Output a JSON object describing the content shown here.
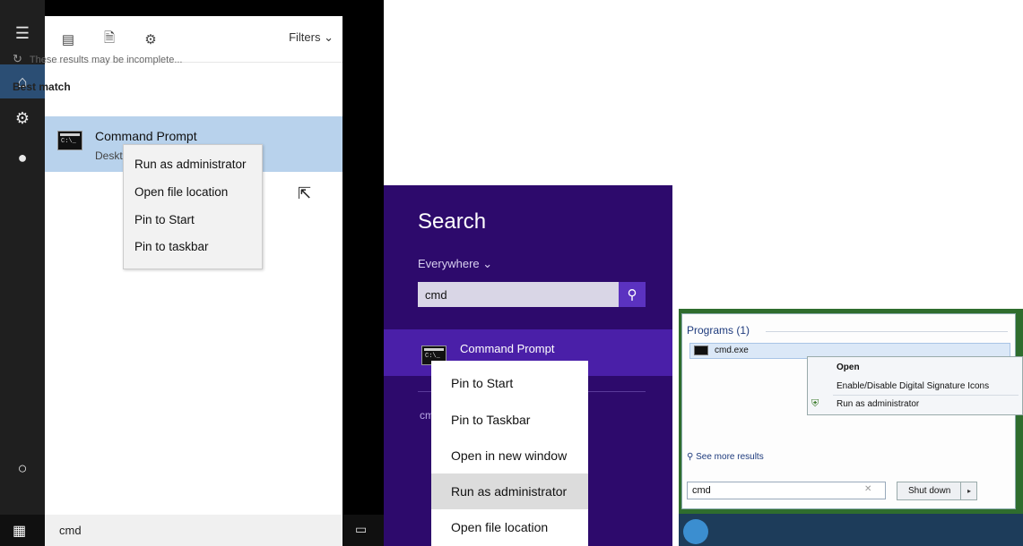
{
  "win10": {
    "rail_icons": [
      "hamburger-icon",
      "home-icon",
      "gear-icon",
      "user-icon",
      "cortana-circle-icon",
      "windows-logo-icon"
    ],
    "toolbar_icons": [
      "apps-icon",
      "documents-icon",
      "settings-icon"
    ],
    "filters_label": "Filters",
    "incomplete_note": "These results may be incomplete...",
    "best_match_heading": "Best match",
    "result_name": "Command Prompt",
    "result_sub": "Deskt",
    "context_menu": [
      "Run as administrator",
      "Open file location",
      "Pin to Start",
      "Pin to taskbar"
    ],
    "search_query": "cmd"
  },
  "win8": {
    "title": "Search",
    "scope": "Everywhere",
    "query": "cmd",
    "result_name": "Command Prompt",
    "sub_fragment": "cm",
    "context_menu": [
      "Pin to Start",
      "Pin to Taskbar",
      "Open in new window",
      "Run as administrator",
      "Open file location"
    ],
    "highlight_index": 3
  },
  "win7": {
    "programs_heading": "Programs (1)",
    "result_name": "cmd.exe",
    "context_menu": [
      "Open",
      "Enable/Disable Digital Signature Icons",
      "Run as administrator"
    ],
    "see_more": "See more results",
    "query": "cmd",
    "shutdown_label": "Shut down"
  }
}
